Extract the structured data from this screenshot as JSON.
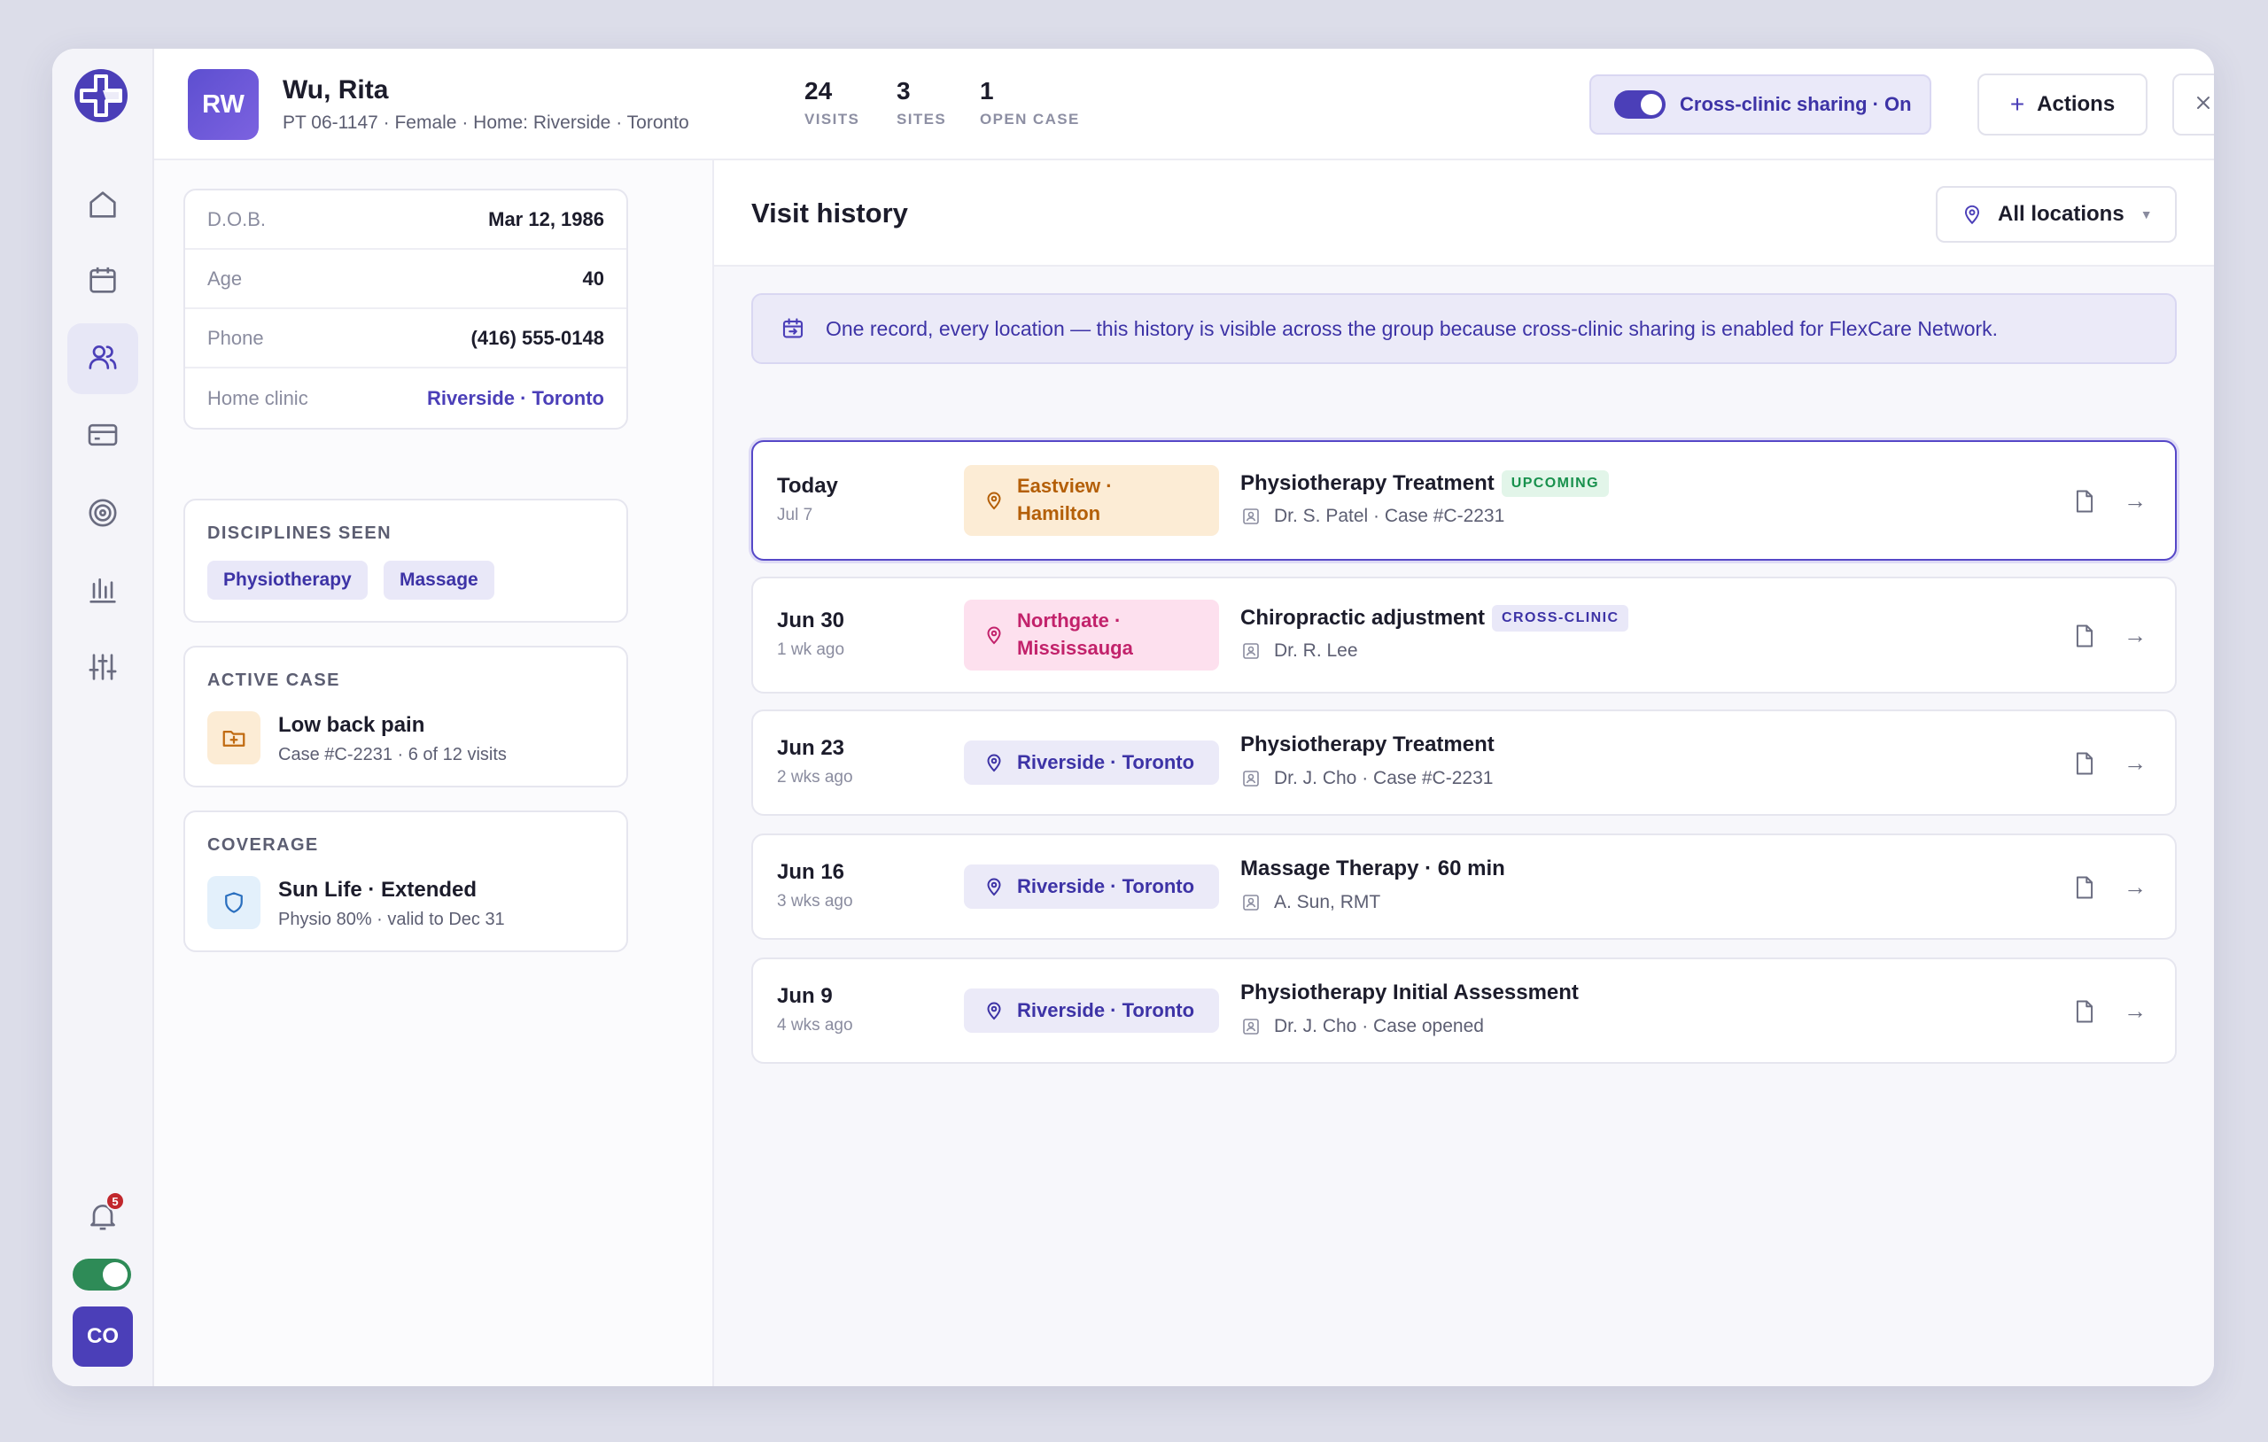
{
  "colors": {
    "accent": "#4b3fb8",
    "background": "#dcdde9",
    "notification_badge": "#c1272d",
    "status_toggle": "#2e8b57"
  },
  "rail": {
    "logo_icon": "flexcare-logo-icon",
    "items": [
      {
        "name": "home",
        "icon": "home-icon",
        "active": false
      },
      {
        "name": "calendar",
        "icon": "calendar-icon",
        "active": false
      },
      {
        "name": "patients",
        "icon": "users-icon",
        "active": true
      },
      {
        "name": "billing",
        "icon": "credit-card-icon",
        "active": false
      },
      {
        "name": "goals",
        "icon": "target-icon",
        "active": false
      },
      {
        "name": "reports",
        "icon": "bar-chart-icon",
        "active": false
      },
      {
        "name": "settings",
        "icon": "sliders-icon",
        "active": false
      }
    ],
    "notifications_count": "5",
    "user_initials": "CO"
  },
  "patient": {
    "initials": "RW",
    "name": "Wu, Rita",
    "meta": "PT 06-1147 · Female · Home: Riverside · Toronto",
    "stats": [
      {
        "num": "24",
        "label": "VISITS"
      },
      {
        "num": "3",
        "label": "SITES"
      },
      {
        "num": "1",
        "label": "OPEN CASE"
      }
    ]
  },
  "header": {
    "sharing_label": "Cross-clinic sharing · On",
    "actions_label": "Actions"
  },
  "details": [
    {
      "key": "D.O.B.",
      "value": "Mar 12, 1986"
    },
    {
      "key": "Age",
      "value": "40"
    },
    {
      "key": "Phone",
      "value": "(416) 555-0148"
    },
    {
      "key": "Home clinic",
      "value": "Riverside · Toronto"
    }
  ],
  "disciplines": {
    "title": "DISCIPLINES SEEN",
    "items": [
      "Physiotherapy",
      "Massage"
    ]
  },
  "active_case": {
    "title": "ACTIVE CASE",
    "name": "Low back pain",
    "sub": "Case #C-2231 · 6 of 12 visits",
    "icon": "folder-plus-icon"
  },
  "coverage": {
    "title": "COVERAGE",
    "name": "Sun Life · Extended",
    "sub": "Physio 80% · valid to Dec 31",
    "icon": "shield-icon"
  },
  "main": {
    "title": "Visit history",
    "location_filter": "All locations",
    "banner": "One record, every location — this history is visible across the group because cross-clinic sharing is enabled for FlexCare Network."
  },
  "visits": [
    {
      "date": "Today",
      "ago": "Jul 7",
      "loc1": "Eastview ·",
      "loc2": "Hamilton",
      "loc_style": "orange",
      "title": "Physiotherapy Treatment",
      "tag": "UPCOMING",
      "tag_style": "green",
      "sub": "Dr. S. Patel · Case #C-2231",
      "selected": true
    },
    {
      "date": "Jun 30",
      "ago": "1 wk ago",
      "loc1": "Northgate ·",
      "loc2": "Mississauga",
      "loc_style": "pink",
      "title": "Chiropractic adjustment",
      "tag": "CROSS-CLINIC",
      "tag_style": "purple",
      "sub": "Dr. R. Lee",
      "selected": false
    },
    {
      "date": "Jun 23",
      "ago": "2 wks ago",
      "loc1": "Riverside · Toronto",
      "loc2": "",
      "loc_style": "purple",
      "title": "Physiotherapy Treatment",
      "tag": "",
      "tag_style": "",
      "sub": "Dr. J. Cho · Case #C-2231",
      "selected": false
    },
    {
      "date": "Jun 16",
      "ago": "3 wks ago",
      "loc1": "Riverside · Toronto",
      "loc2": "",
      "loc_style": "purple",
      "title": "Massage Therapy · 60 min",
      "tag": "",
      "tag_style": "",
      "sub": "A. Sun, RMT",
      "selected": false
    },
    {
      "date": "Jun 9",
      "ago": "4 wks ago",
      "loc1": "Riverside · Toronto",
      "loc2": "",
      "loc_style": "purple",
      "title": "Physiotherapy Initial Assessment",
      "tag": "",
      "tag_style": "",
      "sub": "Dr. J. Cho · Case opened",
      "selected": false
    }
  ]
}
